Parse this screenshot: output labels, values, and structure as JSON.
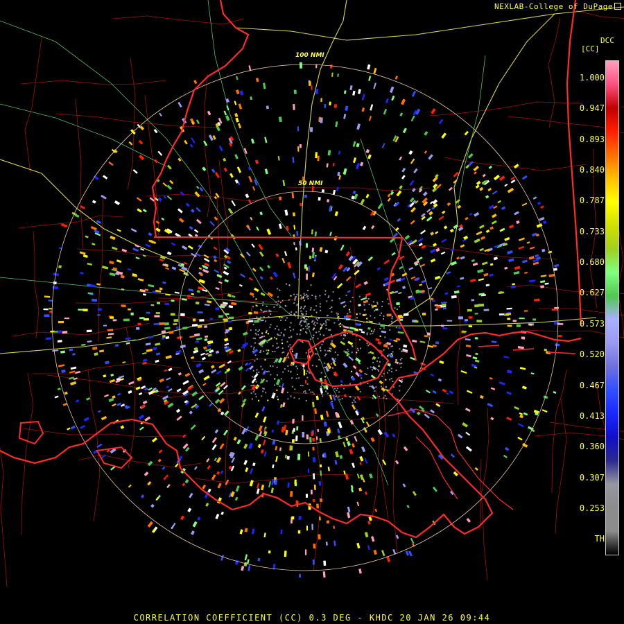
{
  "credit": "NEXLAB-College of DuPage",
  "legend": {
    "product_code": "DCC",
    "unit": "[CC]",
    "ticks": [
      "1.000",
      "0.947",
      "0.893",
      "0.840",
      "0.787",
      "0.733",
      "0.680",
      "0.627",
      "0.573",
      "0.520",
      "0.467",
      "0.413",
      "0.360",
      "0.307",
      "0.253",
      "TH"
    ]
  },
  "ring_labels": {
    "inner": "50 NMI",
    "outer": "100 NMI"
  },
  "footer": "CORRELATION COEFFICIENT (CC) 0.3 DEG - KHDC 20 JAN 26 09:44",
  "colors": {
    "state_border": "#ff2a2a",
    "county_border": "#a01010",
    "interstate": "#ffff55",
    "highway": "#66dd88",
    "range_ring": "#e8c8a8",
    "label": "#ffff33"
  },
  "colorbar_stops": [
    "#000000",
    "#8c8c8c",
    "#8c8c8c",
    "#9696a0",
    "#2a2a90",
    "#1010c8",
    "#1a28ff",
    "#3050ff",
    "#7070dd",
    "#9a9af0",
    "#aab0ff",
    "#50c850",
    "#80ff80",
    "#a0d020",
    "#d0e000",
    "#ffff00",
    "#ffc000",
    "#ff7000",
    "#ff2000",
    "#c00000",
    "#ff5080",
    "#ffa0c0"
  ],
  "icons": {
    "external_link": "external-link-icon"
  }
}
